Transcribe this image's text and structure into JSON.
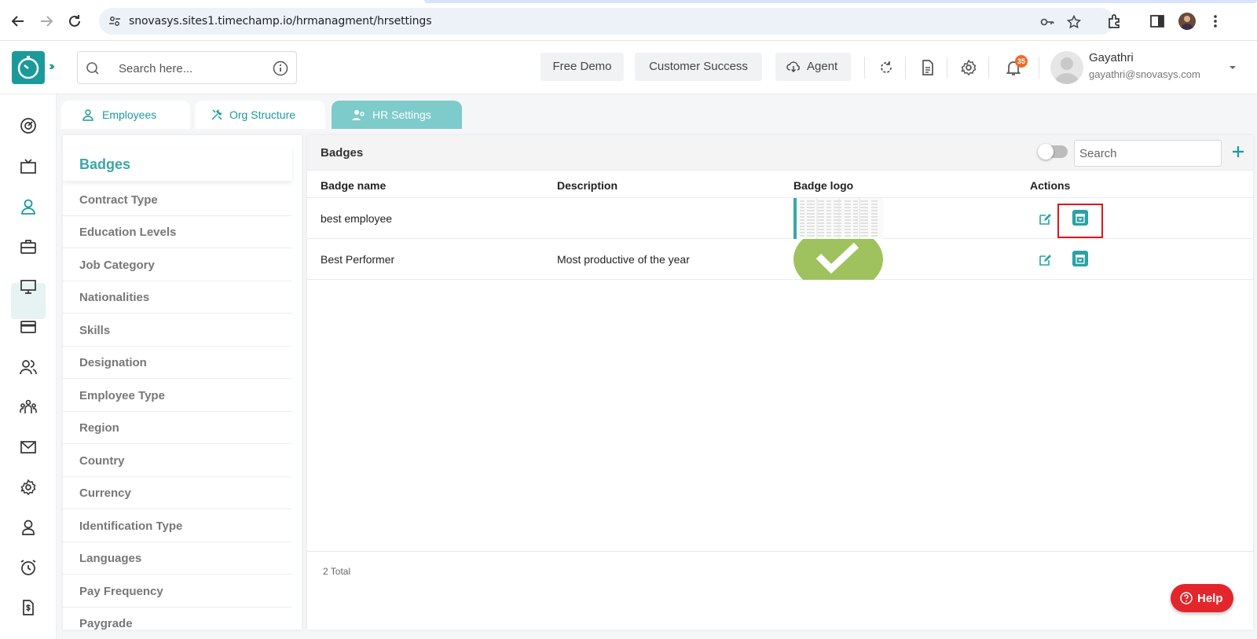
{
  "browser": {
    "url": "snovasys.sites1.timechamp.io/hrmanagment/hrsettings"
  },
  "header": {
    "search_placeholder": "Search here...",
    "buttons": {
      "free_demo": "Free Demo",
      "customer_success": "Customer Success",
      "agent": "Agent"
    },
    "notification_count": "35",
    "user": {
      "name": "Gayathri",
      "email": "gayathri@snovasys.com"
    }
  },
  "tabs": [
    {
      "label": "Employees",
      "active": false
    },
    {
      "label": "Org Structure",
      "active": false
    },
    {
      "label": "HR Settings",
      "active": true
    }
  ],
  "settings": {
    "title": "Badges",
    "items": [
      "Contract Type",
      "Education Levels",
      "Job Category",
      "Nationalities",
      "Skills",
      "Designation",
      "Employee Type",
      "Region",
      "Country",
      "Currency",
      "Identification Type",
      "Languages",
      "Pay Frequency",
      "Paygrade"
    ]
  },
  "main": {
    "title": "Badges",
    "search_placeholder": "Search",
    "columns": {
      "name": "Badge name",
      "description": "Description",
      "logo": "Badge logo",
      "actions": "Actions"
    },
    "rows": [
      {
        "name": "best employee",
        "description": "",
        "logo": "spreadsheet-thumbnail"
      },
      {
        "name": "Best Performer",
        "description": "Most productive of the year",
        "logo": "green-checkmark"
      }
    ],
    "total": "2 Total"
  },
  "help": {
    "label": "Help"
  },
  "colors": {
    "accent": "#1b9a9c",
    "tab_active": "#7ecbcb",
    "highlight": "#e0161c",
    "help": "#e3262c"
  }
}
